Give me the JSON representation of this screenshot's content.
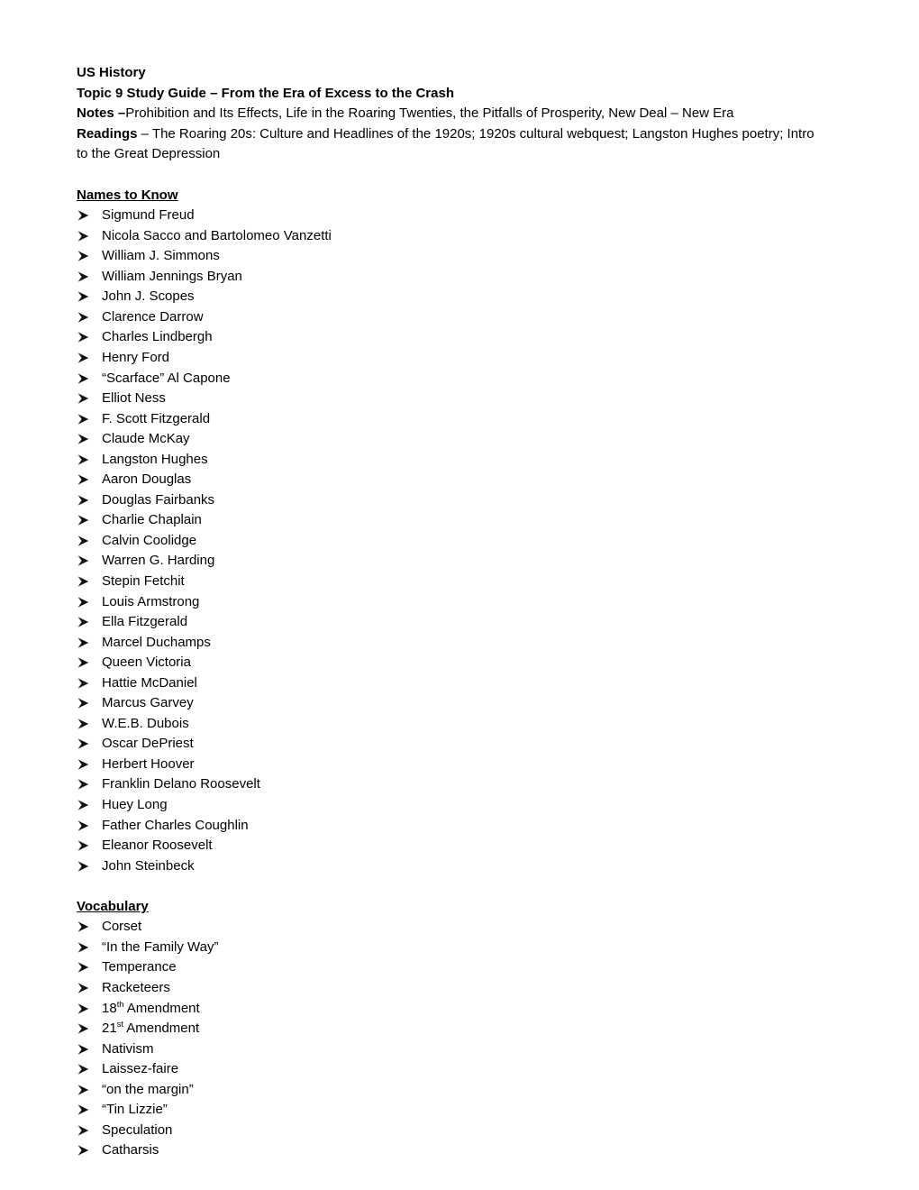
{
  "document": {
    "course": "US History",
    "title": "Topic 9 Study Guide – From the Era of Excess to the Crash",
    "notes_label": "Notes –",
    "notes_text": "Prohibition and Its Effects, Life in the Roaring Twenties, the Pitfalls of Prosperity, New Deal – New Era",
    "readings_label": "Readings",
    "readings_text": " – The Roaring 20s:  Culture and Headlines of the 1920s; 1920s cultural webquest; Langston Hughes poetry; Intro to the Great Depression",
    "bullet_glyph": "➢",
    "text_color": "#000000",
    "background_color": "#ffffff"
  },
  "sections": [
    {
      "heading": "Names to Know",
      "items": [
        "Sigmund Freud",
        "Nicola Sacco and Bartolomeo Vanzetti",
        "William J. Simmons",
        "William Jennings Bryan",
        "John J. Scopes",
        "Clarence Darrow",
        "Charles Lindbergh",
        "Henry Ford",
        "“Scarface” Al Capone",
        "Elliot Ness",
        "F. Scott Fitzgerald",
        "Claude McKay",
        "Langston Hughes",
        "Aaron Douglas",
        "Douglas Fairbanks",
        "Charlie Chaplain",
        "Calvin Coolidge",
        "Warren G. Harding",
        "Stepin Fetchit",
        "Louis Armstrong",
        "Ella Fitzgerald",
        "Marcel Duchamps",
        "Queen Victoria",
        "Hattie McDaniel",
        "Marcus Garvey",
        "W.E.B. Dubois",
        "Oscar DePriest",
        "Herbert Hoover",
        "Franklin Delano Roosevelt",
        "Huey Long",
        "Father Charles Coughlin",
        "Eleanor Roosevelt",
        "John Steinbeck"
      ]
    },
    {
      "heading": "Vocabulary",
      "items": [
        "Corset",
        "“In the Family Way”",
        "Temperance",
        "Racketeers",
        {
          "text": "18",
          "sup": "th",
          "tail": " Amendment"
        },
        {
          "text": "21",
          "sup": "st",
          "tail": " Amendment"
        },
        "Nativism",
        "Laissez-faire",
        "“on the margin”",
        "“Tin Lizzie”",
        "Speculation",
        "Catharsis"
      ]
    }
  ]
}
